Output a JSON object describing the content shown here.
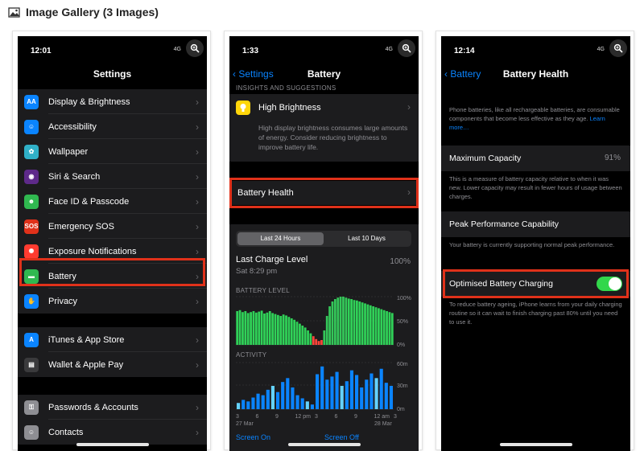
{
  "gallery": {
    "title": "Image Gallery (3 Images)"
  },
  "phone1": {
    "time": "12:01",
    "signal": "4G",
    "title": "Settings",
    "group1": [
      {
        "label": "Display & Brightness",
        "icon": "display-icon",
        "color": "#0a84ff",
        "glyph": "AA"
      },
      {
        "label": "Accessibility",
        "icon": "accessibility-icon",
        "color": "#0a84ff",
        "glyph": "☺"
      },
      {
        "label": "Wallpaper",
        "icon": "wallpaper-icon",
        "color": "#30b0c7",
        "glyph": "✿"
      },
      {
        "label": "Siri & Search",
        "icon": "siri-icon",
        "color": "#5e2a8a",
        "glyph": "◉"
      },
      {
        "label": "Face ID & Passcode",
        "icon": "faceid-icon",
        "color": "#30b850",
        "glyph": "☻"
      },
      {
        "label": "Emergency SOS",
        "icon": "sos-icon",
        "color": "#e0311a",
        "glyph": "SOS"
      },
      {
        "label": "Exposure Notifications",
        "icon": "exposure-icon",
        "color": "#ff3b30",
        "glyph": "✺"
      },
      {
        "label": "Battery",
        "icon": "battery-icon",
        "color": "#30b850",
        "glyph": "▬"
      },
      {
        "label": "Privacy",
        "icon": "privacy-hand-icon",
        "color": "#0a84ff",
        "glyph": "✋"
      }
    ],
    "group2": [
      {
        "label": "iTunes & App Store",
        "icon": "appstore-icon",
        "color": "#0a84ff",
        "glyph": "A"
      },
      {
        "label": "Wallet & Apple Pay",
        "icon": "wallet-icon",
        "color": "#3a3a3c",
        "glyph": "▤"
      }
    ],
    "group3": [
      {
        "label": "Passwords & Accounts",
        "icon": "key-icon",
        "color": "#8e8e93",
        "glyph": "⚿"
      },
      {
        "label": "Contacts",
        "icon": "contacts-icon",
        "color": "#8e8e93",
        "glyph": "☺"
      }
    ]
  },
  "phone2": {
    "time": "1:33",
    "signal": "4G",
    "back": "Settings",
    "title": "Battery",
    "insights_cap": "INSIGHTS AND SUGGESTIONS",
    "insight_title": "High Brightness",
    "insight_body": "High display brightness consumes large amounts of energy. Consider reducing brightness to improve battery life.",
    "health_label": "Battery Health",
    "seg_24": "Last 24 Hours",
    "seg_10": "Last 10 Days",
    "last_charge_label": "Last Charge Level",
    "last_charge_time": "Sat 8:29 pm",
    "last_charge_value": "100%",
    "battery_level_cap": "BATTERY LEVEL",
    "battery_ticks": [
      "100%",
      "50%",
      "0%"
    ],
    "activity_cap": "ACTIVITY",
    "activity_ticks": [
      "60m",
      "30m",
      "0m"
    ],
    "x_ticks": [
      "3",
      "6",
      "9",
      "12 pm",
      "3",
      "6",
      "9",
      "12 am",
      "3"
    ],
    "x_dates": [
      "27 Mar",
      "28 Mar"
    ],
    "screen_on": "Screen On",
    "screen_off": "Screen Off",
    "battery_levels": [
      70,
      72,
      68,
      70,
      66,
      68,
      70,
      67,
      69,
      71,
      65,
      67,
      70,
      66,
      64,
      62,
      60,
      63,
      61,
      58,
      55,
      52,
      48,
      44,
      40,
      36,
      30,
      24,
      18,
      12,
      8,
      10,
      30,
      60,
      80,
      90,
      95,
      98,
      100,
      100,
      98,
      96,
      95,
      93,
      92,
      90,
      88,
      86,
      84,
      82,
      80,
      78,
      76,
      74,
      72,
      70,
      68,
      66
    ],
    "activity_values": [
      8,
      12,
      10,
      15,
      20,
      18,
      25,
      30,
      22,
      35,
      40,
      28,
      18,
      14,
      10,
      6,
      45,
      55,
      38,
      42,
      48,
      30,
      36,
      50,
      44,
      28,
      38,
      46,
      40,
      52,
      34,
      30
    ]
  },
  "phone3": {
    "time": "12:14",
    "signal": "4G",
    "back": "Battery",
    "title": "Battery Health",
    "intro": "Phone batteries, like all rechargeable batteries, are consumable components that become less effective as they age.",
    "learn_more": "Learn more…",
    "max_cap_label": "Maximum Capacity",
    "max_cap_value": "91%",
    "max_cap_desc": "This is a measure of battery capacity relative to when it was new. Lower capacity may result in fewer hours of usage between charges.",
    "peak_label": "Peak Performance Capability",
    "peak_desc": "Your battery is currently supporting normal peak performance.",
    "opt_label": "Optimised Battery Charging",
    "opt_desc": "To reduce battery ageing, iPhone learns from your daily charging routine so it can wait to finish charging past 80% until you need to use it."
  }
}
